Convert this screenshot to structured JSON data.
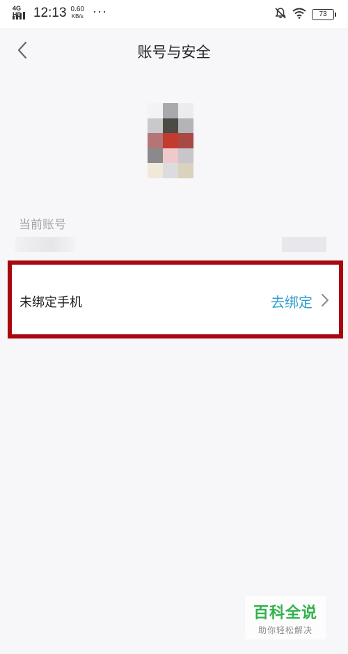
{
  "status_bar": {
    "network": "4G HD",
    "time": "12:13",
    "speed_value": "0.60",
    "speed_unit": "KB/s",
    "more": "···",
    "battery": "73",
    "icons": [
      "signal-icon",
      "mute-bell-icon",
      "wifi-icon",
      "battery-icon"
    ]
  },
  "header": {
    "back_icon": "chevron-left-icon",
    "title": "账号与安全"
  },
  "profile": {
    "avatar": "pixelated-avatar-image"
  },
  "account": {
    "label": "当前账号"
  },
  "phone_binding": {
    "label": "未绑定手机",
    "action": "去绑定",
    "chevron_icon": "chevron-right-icon"
  },
  "watermark": {
    "title": "百科全说",
    "subtitle": "助你轻松解决"
  },
  "colors": {
    "background": "#f7f7f9",
    "action_blue": "#2f9ed0",
    "highlight_red": "#a8070f",
    "watermark_green": "#2fb24a",
    "label_gray": "#a3a3a8"
  }
}
